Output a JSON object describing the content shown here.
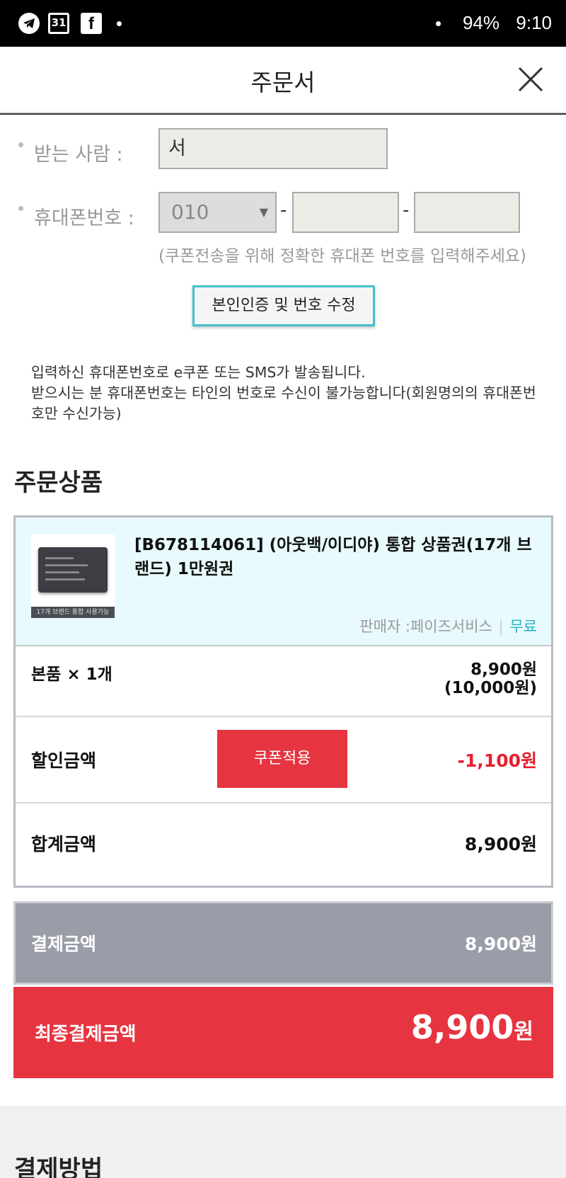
{
  "status_bar": {
    "calendar_day": "31",
    "battery": "94%",
    "time": "9:10"
  },
  "header": {
    "title": "주문서"
  },
  "recipient": {
    "name_label": "받는 사람 :",
    "name_value": "서",
    "phone_label": "휴대폰번호 :",
    "phone_prefix": "010",
    "phone_middle": "",
    "phone_last": "",
    "dash": "-",
    "hint": "(쿠폰전송을 위해 정확한 휴대폰 번호를 입력해주세요)",
    "verify_button": "본인인증 및 번호 수정",
    "notice_line1": "입력하신 휴대폰번호로 e쿠폰 또는 SMS가 발송됩니다.",
    "notice_line2": "받으시는 분 휴대폰번호는 타인의 번호로 수신이 불가능합니다(회원명의의 휴대폰번호만 수신가능)"
  },
  "order_items": {
    "section_title": "주문상품",
    "product": {
      "name": "[B678114061] (아웃백/이디야) 통합 상품권(17개 브랜드) 1만원권",
      "thumb_caption": "17개 브랜드 통합 사용가능",
      "seller_text": "판매자 :페이즈서비스",
      "seller_sep": "|",
      "shipping": "무료"
    },
    "base": {
      "label": "본품 × 1개",
      "price": "8,900원",
      "original_price": "(10,000원)"
    },
    "discount": {
      "label": "할인금액",
      "coupon_button": "쿠폰적용",
      "value": "-1,100원"
    },
    "total": {
      "label": "합계금액",
      "value": "8,900원"
    }
  },
  "payment": {
    "label": "결제금액",
    "value": "8,900원"
  },
  "final": {
    "label": "최종결제금액",
    "amount": "8,900",
    "unit": "원"
  },
  "payment_method": {
    "section_title": "결제방법"
  },
  "colors": {
    "accent_red": "#e63540",
    "accent_teal": "#29b0bf",
    "pay_gray": "#9a9da8",
    "product_bg": "#e8fafd"
  },
  "icons": [
    "telegram-icon",
    "calendar-icon",
    "facebook-icon",
    "close-icon",
    "dropdown-arrow-icon"
  ]
}
